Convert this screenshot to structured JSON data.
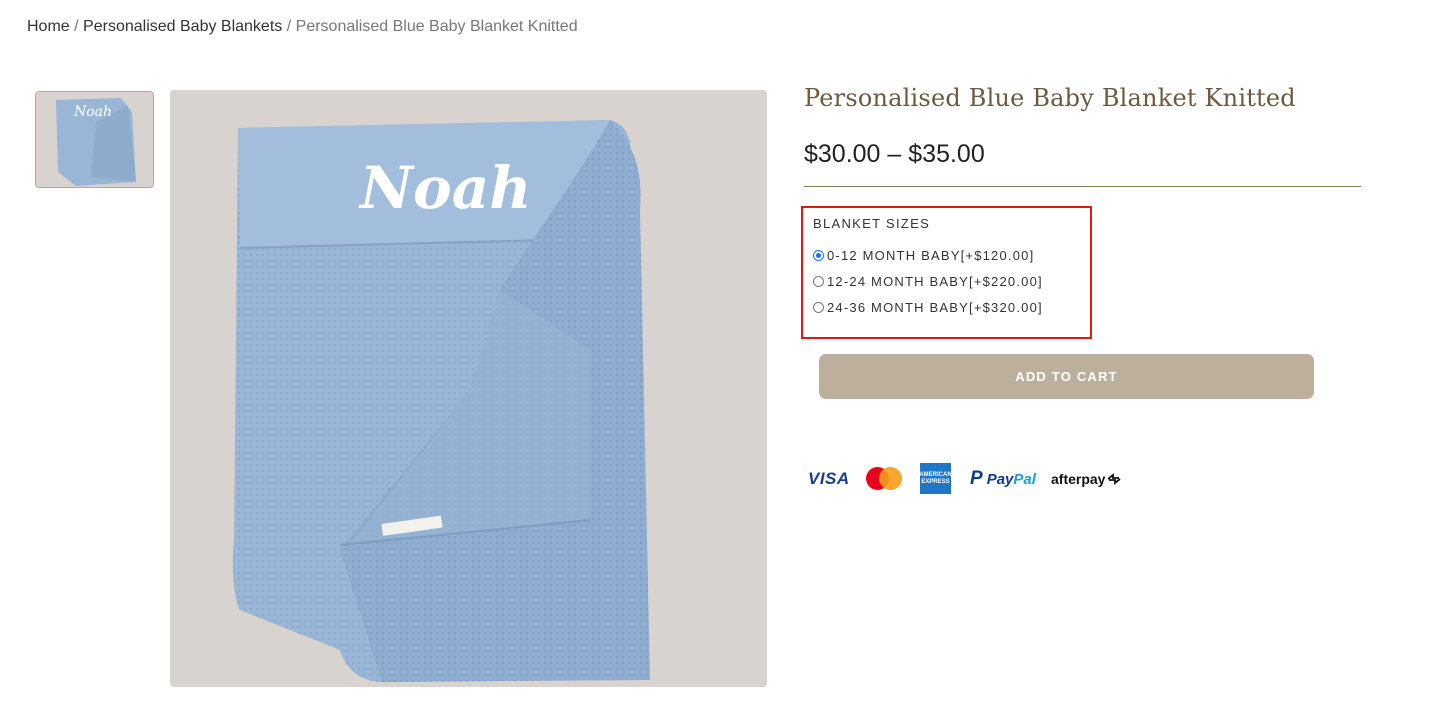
{
  "breadcrumb": {
    "home": "Home",
    "category": "Personalised Baby Blankets",
    "separator": "/",
    "current": "Personalised Blue Baby Blanket Knitted"
  },
  "product": {
    "title": "Personalised Blue Baby Blanket Knitted",
    "price": "$30.00 – $35.00",
    "embroidered_name": "Noah"
  },
  "variants": {
    "label": "BLANKET SIZES",
    "options": [
      {
        "label": "0-12 MONTH BABY[+$120.00]",
        "selected": true
      },
      {
        "label": "12-24 MONTH BABY[+$220.00]",
        "selected": false
      },
      {
        "label": "24-36 MONTH BABY[+$320.00]",
        "selected": false
      }
    ]
  },
  "cart": {
    "button_label": "ADD TO CART"
  },
  "payments": {
    "visa": "VISA",
    "amex": "AMERICAN EXPRESS",
    "paypal_a": "Pay",
    "paypal_b": "Pal",
    "afterpay": "afterpay"
  },
  "colors": {
    "title": "#6b5a3f",
    "accent_button": "#bcb09d",
    "highlight_border": "#e01818",
    "blanket": "#9ab6d6",
    "background_photo": "#d9d3cf"
  }
}
